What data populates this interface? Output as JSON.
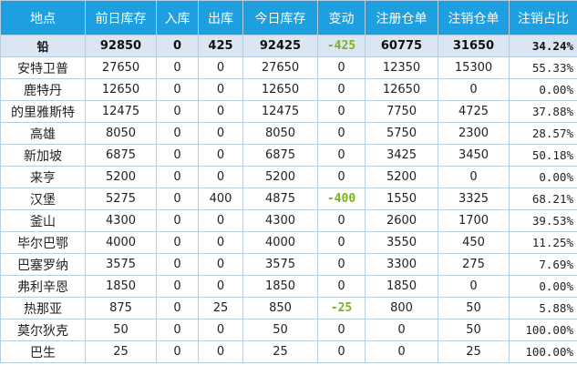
{
  "table": {
    "headers": [
      "地点",
      "前日库存",
      "入库",
      "出库",
      "今日库存",
      "变动",
      "注册仓单",
      "注销仓单",
      "注销占比"
    ],
    "total": [
      "铅",
      "92850",
      "0",
      "425",
      "92425",
      "-425",
      "60775",
      "31650",
      "34.24%"
    ],
    "rows": [
      [
        "安特卫普",
        "27650",
        "0",
        "0",
        "27650",
        "0",
        "12350",
        "15300",
        "55.33%"
      ],
      [
        "鹿特丹",
        "12650",
        "0",
        "0",
        "12650",
        "0",
        "12650",
        "0",
        "0.00%"
      ],
      [
        "的里雅斯特",
        "12475",
        "0",
        "0",
        "12475",
        "0",
        "7750",
        "4725",
        "37.88%"
      ],
      [
        "高雄",
        "8050",
        "0",
        "0",
        "8050",
        "0",
        "5750",
        "2300",
        "28.57%"
      ],
      [
        "新加坡",
        "6875",
        "0",
        "0",
        "6875",
        "0",
        "3425",
        "3450",
        "50.18%"
      ],
      [
        "来亨",
        "5200",
        "0",
        "0",
        "5200",
        "0",
        "5200",
        "0",
        "0.00%"
      ],
      [
        "汉堡",
        "5275",
        "0",
        "400",
        "4875",
        "-400",
        "1550",
        "3325",
        "68.21%"
      ],
      [
        "釜山",
        "4300",
        "0",
        "0",
        "4300",
        "0",
        "2600",
        "1700",
        "39.53%"
      ],
      [
        "毕尔巴鄂",
        "4000",
        "0",
        "0",
        "4000",
        "0",
        "3550",
        "450",
        "11.25%"
      ],
      [
        "巴塞罗纳",
        "3575",
        "0",
        "0",
        "3575",
        "0",
        "3300",
        "275",
        "7.69%"
      ],
      [
        "弗利辛恩",
        "1850",
        "0",
        "0",
        "1850",
        "0",
        "1850",
        "0",
        "0.00%"
      ],
      [
        "热那亚",
        "875",
        "0",
        "25",
        "850",
        "-25",
        "800",
        "50",
        "5.88%"
      ],
      [
        "莫尔狄克",
        "50",
        "0",
        "0",
        "50",
        "0",
        "0",
        "50",
        "100.00%"
      ],
      [
        "巴生",
        "25",
        "0",
        "0",
        "25",
        "0",
        "0",
        "25",
        "100.00%"
      ]
    ]
  },
  "colors": {
    "header_bg": "#1e9fe0",
    "total_bg": "#dbe6f2",
    "negative_change": "#7ab21e",
    "border": "#b7cde2"
  }
}
